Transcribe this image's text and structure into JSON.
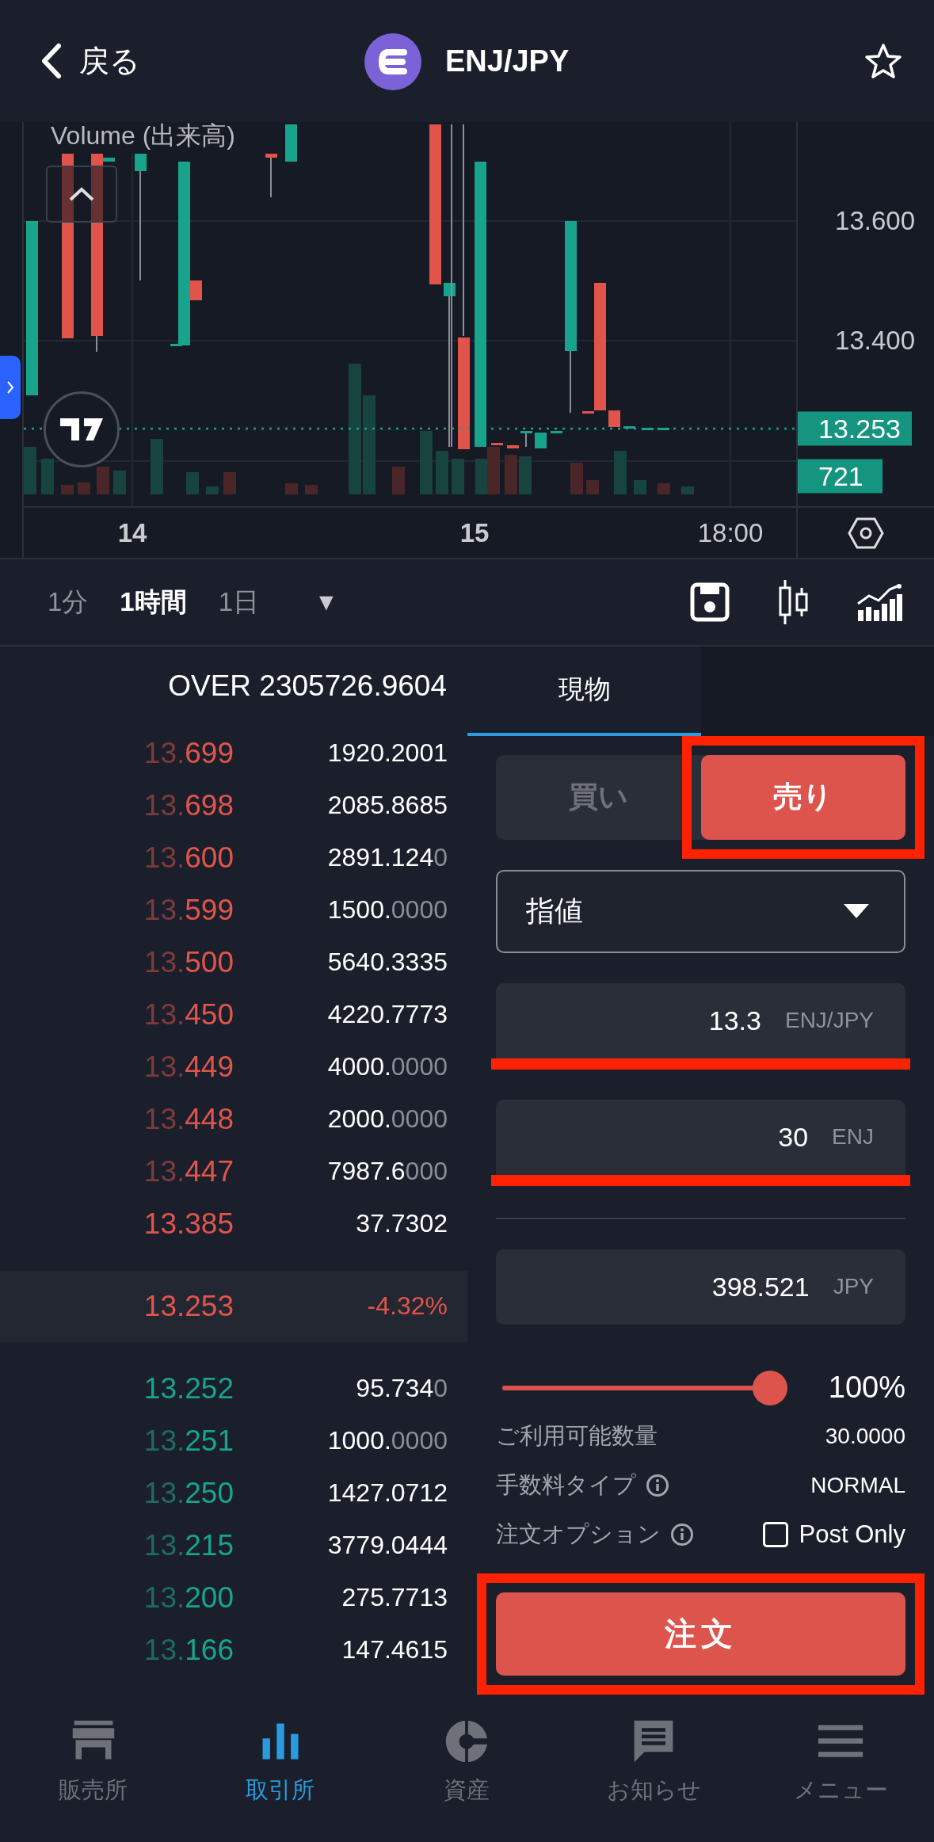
{
  "header": {
    "back_label": "戻る",
    "title": "ENJ/JPY",
    "favorite": false
  },
  "chart": {
    "legend": "Volume (出来高)",
    "y_ticks": [
      "13.600",
      "13.400"
    ],
    "last_price": "13.253",
    "volume_tag": "721",
    "x_ticks": [
      "14",
      "15",
      "18:00"
    ]
  },
  "timeframes": [
    {
      "label": "1分",
      "selected": false
    },
    {
      "label": "1時間",
      "selected": true
    },
    {
      "label": "1日",
      "selected": false
    }
  ],
  "timeframe_menu": "▼",
  "order_book": {
    "header": "OVER 2305726.9604",
    "asks": [
      {
        "price": "13.699",
        "amount": "1920.2001",
        "faded_prefix": true
      },
      {
        "price": "13.698",
        "amount": "2085.8685",
        "faded_prefix": true
      },
      {
        "price": "13.600",
        "amount": "2891.1240",
        "faded_prefix": true
      },
      {
        "price": "13.599",
        "amount": "1500.0000",
        "faded_prefix": true
      },
      {
        "price": "13.500",
        "amount": "5640.3335",
        "faded_prefix": true
      },
      {
        "price": "13.450",
        "amount": "4220.7773",
        "faded_prefix": true
      },
      {
        "price": "13.449",
        "amount": "4000.0000",
        "faded_prefix": true
      },
      {
        "price": "13.448",
        "amount": "2000.0000",
        "faded_prefix": true
      },
      {
        "price": "13.447",
        "amount": "7987.6000",
        "faded_prefix": true
      },
      {
        "price": "13.385",
        "amount": "37.7302",
        "faded_prefix": false
      }
    ],
    "mid": {
      "price": "13.253",
      "change": "-4.32%"
    },
    "bids": [
      {
        "price": "13.252",
        "amount": "95.7340",
        "faded_prefix": false
      },
      {
        "price": "13.251",
        "amount": "1000.0000",
        "faded_prefix": true
      },
      {
        "price": "13.250",
        "amount": "1427.0712",
        "faded_prefix": true
      },
      {
        "price": "13.215",
        "amount": "3779.0444",
        "faded_prefix": true
      },
      {
        "price": "13.200",
        "amount": "275.7713",
        "faded_prefix": true
      },
      {
        "price": "13.166",
        "amount": "147.4615",
        "faded_prefix": true
      }
    ]
  },
  "order_form": {
    "tabs": [
      {
        "label": "現物",
        "selected": true
      }
    ],
    "sides": [
      {
        "label": "買い",
        "selected": false,
        "highlighted": false
      },
      {
        "label": "売り",
        "selected": true,
        "highlighted": true
      }
    ],
    "order_type": "指値",
    "fields": [
      {
        "value": "13.3",
        "unit": "ENJ/JPY",
        "highlighted": true
      },
      {
        "value": "30",
        "unit": "ENJ",
        "highlighted": true
      }
    ],
    "total": {
      "value": "398.521",
      "unit": "JPY"
    },
    "slider": {
      "level": 1,
      "reading": "100%"
    },
    "info_rows": [
      {
        "label": "ご利用可能数量",
        "value": "30.0000",
        "info": false
      },
      {
        "label": "手数料タイプ",
        "value": "NORMAL",
        "info": true
      }
    ],
    "option": {
      "label": "注文オプション",
      "info": true,
      "checkbox_label": "Post Only",
      "checked": false
    },
    "submit": {
      "label": "注文",
      "highlighted": true
    }
  },
  "nav": [
    {
      "label": "販売所",
      "selected": false
    },
    {
      "label": "取引所",
      "selected": true
    },
    {
      "label": "資産",
      "selected": false
    },
    {
      "label": "お知らせ",
      "selected": false
    },
    {
      "label": "メニュー",
      "selected": false
    }
  ]
}
